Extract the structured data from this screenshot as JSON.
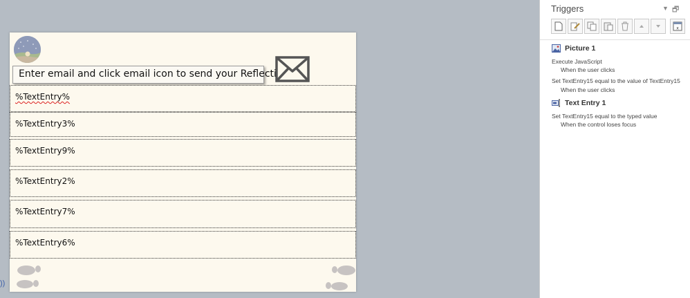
{
  "slide": {
    "email_prompt": "Enter email and click email icon to send your Reflections.",
    "entries": [
      "%TextEntry%",
      "%TextEntry3%",
      "%TextEntry9%",
      "%TextEntry2%",
      "%TextEntry7%",
      "%TextEntry6%"
    ]
  },
  "panel": {
    "title": "Triggers",
    "triggers": [
      {
        "object": "Picture 1",
        "actions": [
          {
            "action": "Execute JavaScript",
            "condition": "When the user clicks"
          },
          {
            "action": "Set TextEntry15 equal to the value of TextEntry15",
            "condition": "When the user clicks"
          }
        ]
      },
      {
        "object": "Text Entry 1",
        "actions": [
          {
            "action": "Set TextEntry15 equal to the typed value",
            "condition": "When the control loses focus"
          }
        ]
      }
    ]
  },
  "colors": {
    "workspace": "#b5bcc4",
    "slide_bg": "#fdf9ee",
    "panel_bg": "#ffffff",
    "footprint": "#c7c3c2",
    "envelope": "#555555"
  },
  "icons": {
    "new_trigger": "new-trigger-icon",
    "edit_trigger": "edit-trigger-icon",
    "copy_trigger": "copy-trigger-icon",
    "paste_trigger": "paste-trigger-icon",
    "delete_trigger": "delete-trigger-icon",
    "move_up": "move-up-icon",
    "move_down": "move-down-icon",
    "variables": "variables-icon"
  }
}
